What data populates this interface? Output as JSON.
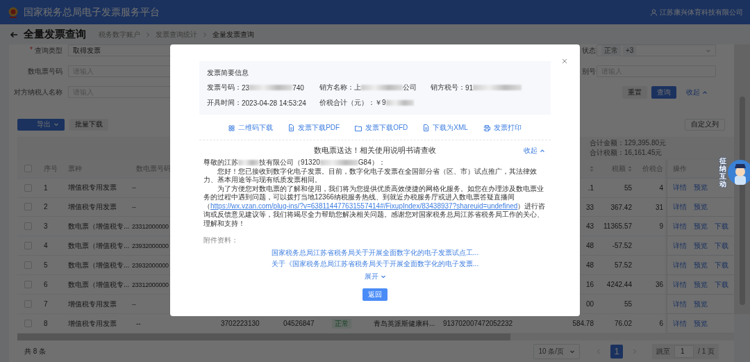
{
  "header": {
    "title": "国家税务总局电子发票服务平台",
    "user": "江苏康兴体育科技有限公司"
  },
  "page": {
    "title": "全量发票查询",
    "breadcrumb": [
      {
        "label": "税务数字账户",
        "current": false
      },
      {
        "label": "发票查询统计",
        "current": false
      },
      {
        "label": "全量发票查询",
        "current": true
      }
    ]
  },
  "filters_left": [
    {
      "required_mark": "*",
      "label": "查询类型",
      "value": "取得发票"
    },
    {
      "label": "数电票号码",
      "placeholder": "请输入"
    },
    {
      "label": "对方纳税人名称",
      "placeholder": "请输入"
    }
  ],
  "filters_right": [
    {
      "kind": "tags",
      "label": "状态",
      "tags": [
        "正常",
        "+3"
      ]
    },
    {
      "kind": "input",
      "label": "别号",
      "placeholder": "请输入"
    }
  ],
  "filter_buttons": [
    {
      "kind": "default",
      "label": "重置"
    },
    {
      "kind": "primary",
      "label": "查询"
    },
    {
      "kind": "link",
      "label": "收起"
    }
  ],
  "toolbar": {
    "export": "导出",
    "batch_download": "批量下载",
    "columns": "自定义列"
  },
  "summary": [
    "合计金额：129,395.80元",
    "合计税额：16,161.45元"
  ],
  "table": {
    "header_checked": false,
    "columns_left": [
      "序号",
      "票种",
      "数电票号码"
    ],
    "columns_right": [
      "税额",
      "价税合"
    ],
    "actions_column": "操作",
    "rows": [
      {
        "checked": false,
        "index": "1",
        "type": "增值税专用发票",
        "number": "--",
        "amount_tail": ".1",
        "tax": "55",
        "total_head": "4",
        "actions": [
          "详情",
          "预览"
        ]
      },
      {
        "checked": false,
        "index": "2",
        "type": "增值税专用发票",
        "number": "--",
        "amount_tail": "33",
        "tax": "367.42",
        "total_head": "31",
        "actions": [
          "详情",
          "预览"
        ]
      },
      {
        "checked": false,
        "index": "3",
        "type": "数电票（增值税专...",
        "number": "23312000000",
        "amount_tail": "43",
        "tax": "11365.57",
        "total_head": "9",
        "actions": [
          "详情",
          "预览",
          "下载"
        ]
      },
      {
        "checked": false,
        "index": "4",
        "type": "数电票（增值税专...",
        "number": "23932000000",
        "amount_tail": "48",
        "tax": "-57.52",
        "actions": [
          "详情",
          "预览",
          "下载"
        ]
      },
      {
        "checked": false,
        "index": "5",
        "type": "数电票（增值税专...",
        "number": "23932000000",
        "amount_tail": "48",
        "tax": "57.52",
        "actions": [
          "详情",
          "预览",
          "下载"
        ]
      },
      {
        "checked": false,
        "index": "6",
        "type": "数电票（增值税专...",
        "number": "23312000000",
        "amount_tail": "16",
        "tax": "4242.44",
        "total_head": "36",
        "actions": [
          "详情",
          "预览",
          "下载"
        ]
      },
      {
        "checked": false,
        "index": "7",
        "type": "增值税专用发票",
        "number": "--",
        "amount_tail": "00",
        "tax": "55",
        "actions": [
          "详情",
          "预览"
        ]
      }
    ],
    "bottom_row": {
      "checked": false,
      "index": "8",
      "type": "增值税专用发票",
      "number": "--",
      "code": "3702223130",
      "invoice_no": "04526847",
      "status": "正常",
      "seller": "青岛英派斯健康科...",
      "seller_tax_id": "913702007472052232",
      "amount": "584.78",
      "tax": "76.02",
      "total_head": "6",
      "actions": [
        "详情",
        "预览"
      ]
    }
  },
  "pagination": {
    "total": "共 8 条",
    "page_size": "10 条/页",
    "pages": [
      {
        "label": "1",
        "selected": true
      }
    ],
    "jump_label": "跳至",
    "jump_value": "1",
    "page_count": "/ 1 页"
  },
  "mascot": {
    "label": "征纳互动"
  },
  "dialog": {
    "info_title": "发票简要信息",
    "info": [
      {
        "label": "发票号码：",
        "head": "23",
        "redacted": true,
        "tail": "740"
      },
      {
        "label": "销方名称：",
        "head": "上",
        "redacted": true,
        "tail": "公司"
      },
      {
        "label": "销方税号：",
        "head": "91",
        "redacted": true
      },
      {
        "label": "开具时间：",
        "head": "2023-04-28 14:53:24"
      },
      {
        "label": "价税合计（元）：",
        "head": "￥9",
        "redacted": true
      }
    ],
    "actions": [
      {
        "kind": "qr",
        "label": "二维码下载"
      },
      {
        "kind": "pdf",
        "label": "发票下载PDF"
      },
      {
        "kind": "ofd",
        "label": "发票下载OFD"
      },
      {
        "kind": "xml",
        "label": "下载为XML"
      },
      {
        "kind": "print",
        "label": "发票打印"
      }
    ],
    "notice_title": "数电票送达！相关使用说明书请查收",
    "collapse": "收起",
    "greeting": [
      "尊敬的江苏",
      "技有限公司（91320",
      "G84）："
    ],
    "paragraph_1": "您好！您已接收到数字化电子发票。目前，数字化电子发票在全国部分省（区、市）试点推广，其法律效力、基本用途等与现有纸质发票相同。",
    "paragraph_2": {
      "before": "为了方便您对数电票的了解和使用，我们将为您提供优质高效便捷的网格化服务。如您在办理涉及数电票业务的过程中遇到问题，可以拨打当地12366纳税服务热线、到就近办税服务厅或进入数电票答疑直播间（",
      "link": "https://wx.vzan.com/plug-ins/?v=638114477631557414#/FixupIndex/83438937?shareuid=undefined",
      "after": "）进行咨询或反馈意见建议等，我们将竭尽全力帮助您解决相关问题。感谢您对国家税务总局江苏省税务局工作的关心、理解和支持！"
    },
    "attachments_label": "附件资料：",
    "attachments": [
      "国家税务总局江苏省税务局关于开展全面数字化的电子发票试点工...",
      "关于《国家税务总局江苏省税务局关于开展全面数字化的电子发票..."
    ],
    "expand": "展开",
    "back_button": "返回"
  }
}
